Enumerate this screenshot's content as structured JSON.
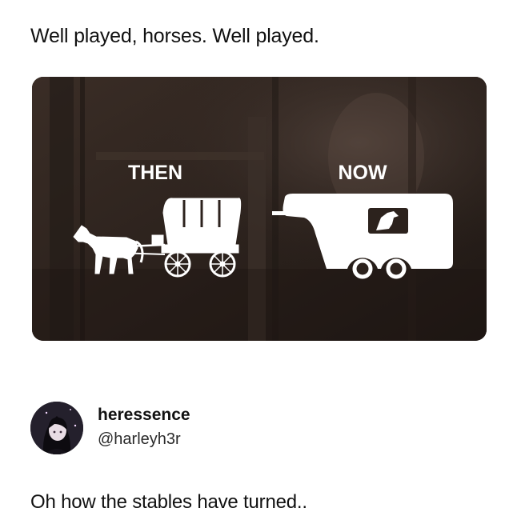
{
  "post": {
    "text": "Well played, horses. Well played."
  },
  "image": {
    "left_label": "THEN",
    "right_label": "NOW",
    "left_icon": "horse-drawn-wagon-icon",
    "right_icon": "horse-trailer-icon"
  },
  "reply": {
    "author_name": "heressence",
    "author_handle": "@harleyh3r",
    "text": "Oh how the stables have turned.."
  }
}
